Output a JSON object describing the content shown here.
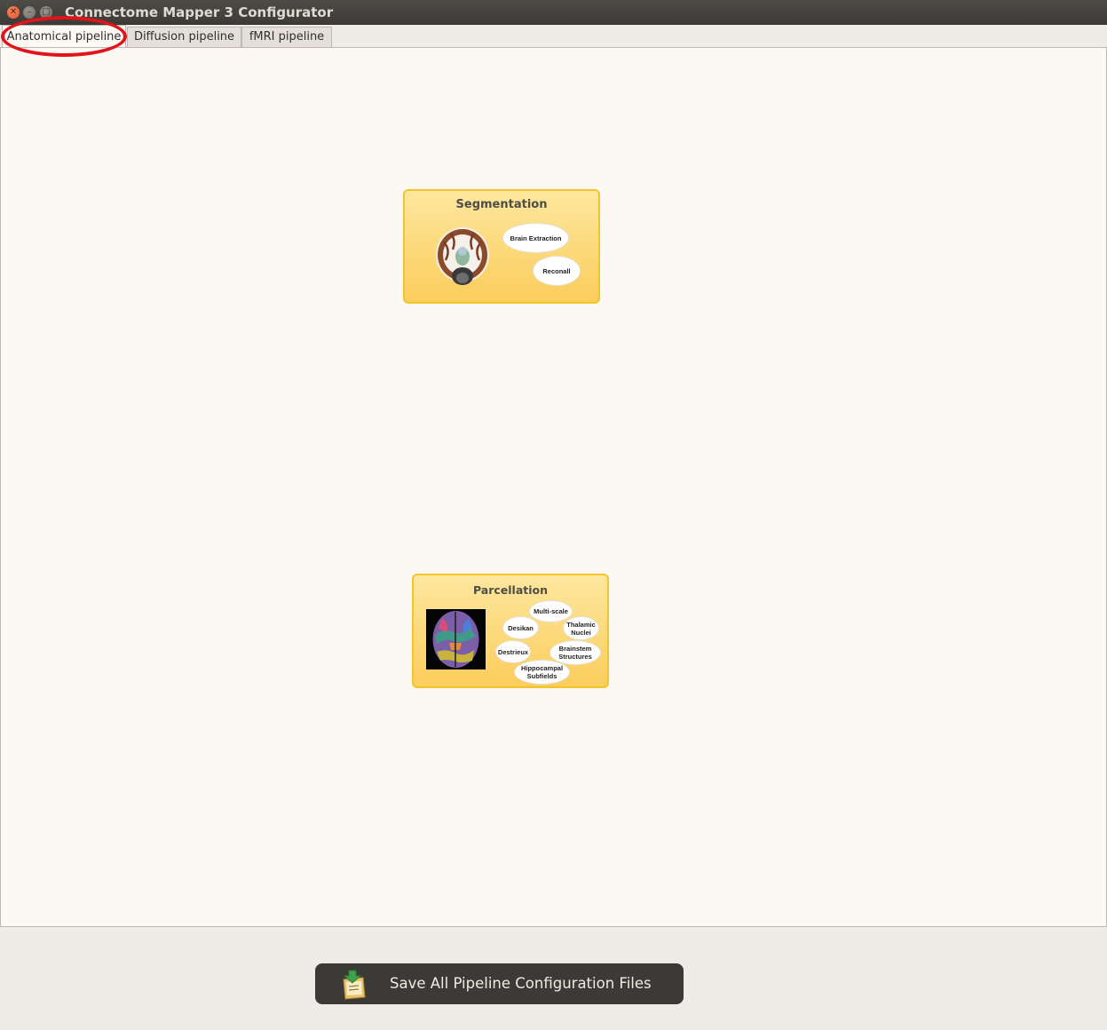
{
  "window": {
    "title": "Connectome Mapper 3 Configurator"
  },
  "tabs": [
    {
      "label": "Anatomical pipeline",
      "active": true
    },
    {
      "label": "Diffusion pipeline",
      "active": false
    },
    {
      "label": "fMRI pipeline",
      "active": false
    }
  ],
  "stages": {
    "segmentation": {
      "title": "Segmentation",
      "options": [
        "Brain Extraction",
        "Reconall"
      ]
    },
    "parcellation": {
      "title": "Parcellation",
      "options": [
        "Multi-scale",
        "Desikan",
        "Thalamic Nuclei",
        "Destrieux",
        "Brainstem Structures",
        "Hippocampal Subfields"
      ]
    }
  },
  "footer": {
    "save_label": "Save All Pipeline Configuration Files"
  },
  "colors": {
    "stage_border": "#f2c52a",
    "stage_fill": "#fbcd5c",
    "highlight": "#e0151b",
    "button_bg": "#3b3a37"
  }
}
